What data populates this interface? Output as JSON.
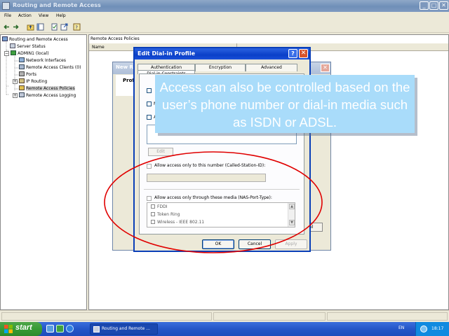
{
  "window": {
    "title": "Routing and Remote Access",
    "buttons": {
      "minimize": "_",
      "maximize": "□",
      "close": "✕"
    }
  },
  "menu": [
    "File",
    "Action",
    "View",
    "Help"
  ],
  "toolbar": {
    "icons": [
      "back-icon",
      "forward-icon",
      "up-folder-icon",
      "show-hide-tree-icon",
      "properties-icon",
      "export-icon",
      "help-icon"
    ]
  },
  "tree": {
    "items": [
      {
        "label": "Routing and Remote Access",
        "icon": "routing-icon"
      },
      {
        "label": "Server Status",
        "icon": "server-icon"
      },
      {
        "label": "ADMIN1 (local)",
        "icon": "server-local-icon",
        "expander": "−"
      },
      {
        "label": "Network Interfaces",
        "icon": "network-icon"
      },
      {
        "label": "Remote Access Clients (0)",
        "icon": "clients-icon"
      },
      {
        "label": "Ports",
        "icon": "ports-icon"
      },
      {
        "label": "IP Routing",
        "icon": "ip-routing-icon",
        "expander": "+"
      },
      {
        "label": "Remote Access Policies",
        "icon": "policies-icon",
        "selected": true
      },
      {
        "label": "Remote Access Logging",
        "icon": "logging-icon",
        "expander": "+"
      }
    ]
  },
  "right_pane": {
    "title": "Remote Access Policies",
    "column": "Name"
  },
  "back_dialog": {
    "title": "New Re",
    "section": "Profi",
    "cancel": "cel"
  },
  "dialog": {
    "title": "Edit Dial-in Profile",
    "help_button": "?",
    "close_button": "✕",
    "tabs": [
      "Authentication",
      "Encryption",
      "Advanced"
    ],
    "front_tab_partial": "Dial-in Constraints",
    "partial_checks": [
      "M",
      "A"
    ],
    "edit_button": "Edit",
    "called_station_label": "Allow access only to this number (Called-Station-ID):",
    "called_station_value": "",
    "nas_port_label": "Allow access only through these media (NAS-Port-Type):",
    "media_options": [
      "FDDI",
      "Token Ring",
      "Wireless - IEEE 802.11"
    ],
    "ok_label": "OK",
    "cancel_label": "Cancel",
    "apply_label": "Apply"
  },
  "callout": {
    "text": "Access can also be controlled based on the user’s phone number or dial-in media such as ISDN or ADSL.",
    "background": "#a9dcfa",
    "ellipse_color": "#e00000"
  },
  "taskbar": {
    "start_label": "start",
    "task": "Routing and Remote ...",
    "language": "EN",
    "clock": "18:17"
  }
}
